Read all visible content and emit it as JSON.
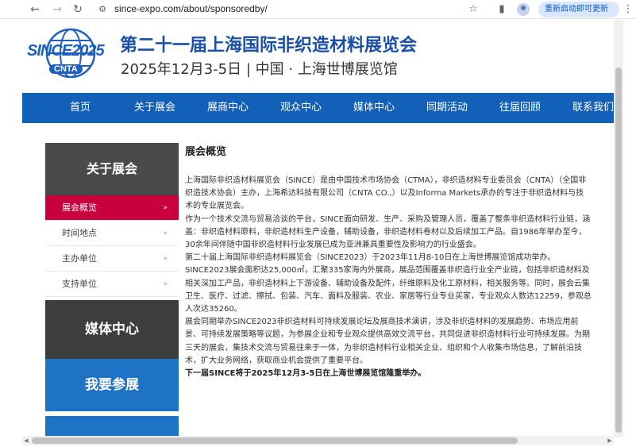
{
  "browser": {
    "url": "since-expo.com/about/sponsoredby/",
    "update_label": "重新启动即可更新",
    "back_icon": "arrow-left-icon",
    "forward_icon": "arrow-right-icon",
    "reload_icon": "reload-icon"
  },
  "header": {
    "logo_text": "SINCE2025",
    "logo_sub": "CNTA",
    "title": "第二十一届上海国际非织造材料展览会",
    "subtitle": "2025年12月3-5日 | 中国 · 上海世博展览馆"
  },
  "nav": {
    "items": [
      "首页",
      "关于展会",
      "展商中心",
      "观众中心",
      "媒体中心",
      "同期活动",
      "往届回顾",
      "联系我们"
    ]
  },
  "sidebar": {
    "heading": "关于展会",
    "items": [
      "展会概览",
      "时间地点",
      "主办单位",
      "支持单位"
    ],
    "arrow": "»",
    "media_label": "媒体中心",
    "register_label": "我要参展"
  },
  "content": {
    "title": "展会概览",
    "paragraphs": [
      "上海国际非织造材料展览会（SINCE）是由中国技术市场协会（CTMA），非织造材料专业委员会（CNTA）（全国非织造技术协会）主办，上海希达科技有限公司（CNTA CO.,）以及Informa Markets承办的专注于非织造材料与技术的专业展览会。",
      "作为一个技术交流与贸易洽谈的平台，SINCE面向研发、生产、采购及管理人员，覆盖了整条非织造材料行业链，涵盖：非织造材料原料，非织造材料生产设备，辅助设备，非织造材料卷材以及后续加工产品。自1986年举办至今，30余年间伴随中国非织造材料行业发展已成为亚洲兼具重要性及影响力的行业盛会。",
      "第二十届上海国际非织造材料展览会（SINCE2023）于2023年11月8-10日在上海世博展览馆成功举办。SINCE2023展会面积达25,000㎡，汇聚335家海内外展商，展品范围覆盖非织造行业全产业链，包括非织造材料及相关深加工产品，非织造材料上下游设备、辅助设备及配件，纤维原料及化工原材料，相关服务等。同时，展会云集卫生、医疗、过滤、擦拭、包装、汽车、面料及服装、农业、家居等行业专业买家，专业观众人数达12259，参观总人次达35260。",
      "展会同期举办SINCE2023非织造材料可持续发展论坛及展商技术演讲，涉及非织造材料的发展趋势、市场应用前景、可持续发展策略等议题，为参展企业和专业观众提供高效交流平台，共同促进非织造材料行业可持续发展。为期三天的展会，集技术交流与贸易往来于一体，为非织造材料行业相关企业、组织和个人收集市场信息，了解前沿技术，扩大业务网络，获取商业机会提供了重要平台。",
      "下一届SINCE将于2025年12月3-5日在上海世博展览馆隆重举办。"
    ]
  },
  "colors": {
    "nav_blue": "#1360b8",
    "title_blue": "#1a4fa8",
    "active_red": "#c8003e",
    "sidebar_dark": "#4a4a4a",
    "block_blue": "#1e73c6"
  }
}
